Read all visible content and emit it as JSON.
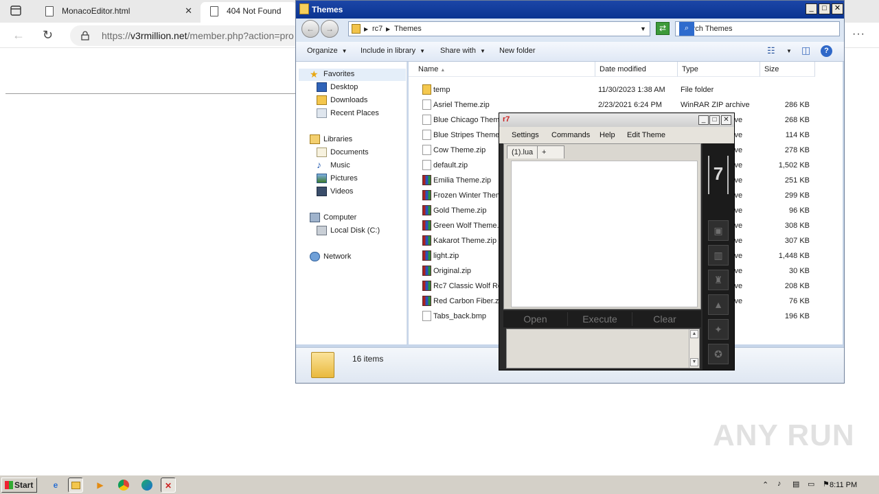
{
  "browser": {
    "tabs": [
      {
        "label": "MonacoEditor.html",
        "close": "✕"
      },
      {
        "label": "404 Not Found"
      }
    ],
    "url_domain": "v3rmillion.net",
    "url_prefix": "https://",
    "url_path": "/member.php?action=pro",
    "more": "···"
  },
  "explorer": {
    "title": "Themes",
    "breadcrumb": [
      "rc7",
      "Themes"
    ],
    "search_placeholder": "Search Themes",
    "toolbar": {
      "organize": "Organize",
      "include": "Include in library",
      "share": "Share with",
      "new_folder": "New folder"
    },
    "nav": {
      "favorites": "Favorites",
      "desktop": "Desktop",
      "downloads": "Downloads",
      "recent": "Recent Places",
      "libraries": "Libraries",
      "documents": "Documents",
      "music": "Music",
      "pictures": "Pictures",
      "videos": "Videos",
      "computer": "Computer",
      "local_disk": "Local Disk (C:)",
      "network": "Network"
    },
    "columns": {
      "name": "Name",
      "date": "Date modified",
      "type": "Type",
      "size": "Size"
    },
    "files": [
      {
        "name": "temp",
        "date": "11/30/2023 1:38 AM",
        "type": "File folder",
        "size": "",
        "icon": "folder-icon"
      },
      {
        "name": "Asriel Theme.zip",
        "date": "2/23/2021 6:24 PM",
        "type": "WinRAR ZIP archive",
        "size": "286 KB",
        "icon": "zip-icon"
      },
      {
        "name": "Blue Chicago Theme",
        "date": "",
        "type": "ive",
        "size": "268 KB",
        "icon": "zip-icon"
      },
      {
        "name": "Blue Stripes Theme.",
        "date": "",
        "type": "ive",
        "size": "114 KB",
        "icon": "zip-icon"
      },
      {
        "name": "Cow Theme.zip",
        "date": "",
        "type": "ive",
        "size": "278 KB",
        "icon": "zip-icon"
      },
      {
        "name": "default.zip",
        "date": "",
        "type": "ive",
        "size": "1,502 KB",
        "icon": "zip-icon"
      },
      {
        "name": "Emilia Theme.zip",
        "date": "",
        "type": "ive",
        "size": "251 KB",
        "icon": "rar-icon"
      },
      {
        "name": "Frozen Winter Them",
        "date": "",
        "type": "ive",
        "size": "299 KB",
        "icon": "rar-icon"
      },
      {
        "name": "Gold Theme.zip",
        "date": "",
        "type": "ive",
        "size": "96 KB",
        "icon": "rar-icon"
      },
      {
        "name": "Green Wolf Theme.z",
        "date": "",
        "type": "ive",
        "size": "308 KB",
        "icon": "rar-icon"
      },
      {
        "name": "Kakarot Theme.zip",
        "date": "",
        "type": "ive",
        "size": "307 KB",
        "icon": "rar-icon"
      },
      {
        "name": "light.zip",
        "date": "",
        "type": "ive",
        "size": "1,448 KB",
        "icon": "rar-icon"
      },
      {
        "name": "Original.zip",
        "date": "",
        "type": "ive",
        "size": "30 KB",
        "icon": "rar-icon"
      },
      {
        "name": "Rc7 Classic Wolf Re",
        "date": "",
        "type": "ive",
        "size": "208 KB",
        "icon": "rar-icon"
      },
      {
        "name": "Red Carbon Fiber.zi",
        "date": "",
        "type": "ive",
        "size": "76 KB",
        "icon": "rar-icon"
      },
      {
        "name": "Tabs_back.bmp",
        "date": "",
        "type": "",
        "size": "196 KB",
        "icon": "bmp-icon"
      }
    ],
    "status_count": "16 items"
  },
  "rc7": {
    "menu": {
      "settings": "Settings",
      "commands": "Commands",
      "help": "Help",
      "edit_theme": "Edit Theme"
    },
    "tabs": [
      "(1).lua",
      "+"
    ],
    "actions": {
      "open": "Open",
      "execute": "Execute",
      "clear": "Clear"
    }
  },
  "taskbar": {
    "start": "Start",
    "clock": "8:11 PM"
  },
  "watermark": "ANY RUN"
}
